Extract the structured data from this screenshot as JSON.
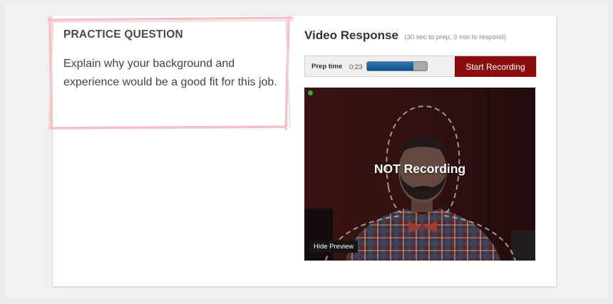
{
  "question": {
    "heading": "PRACTICE QUESTION",
    "text": "Explain why your background and experience would be a good fit for this job."
  },
  "video_response": {
    "title": "Video Response",
    "note": "(30 sec to prep, 3 min to respond)",
    "prep_label": "Prep time",
    "prep_time": "0:23",
    "prep_progress": 0.77,
    "start_button": "Start Recording",
    "status": "NOT Recording",
    "hide_preview": "Hide Preview",
    "indicator_color": "#2fae3a"
  },
  "colors": {
    "record_button": "#8b0e0e",
    "progress_fill": "#0b4f8c",
    "frame_sketch": "#f4c2c6"
  }
}
